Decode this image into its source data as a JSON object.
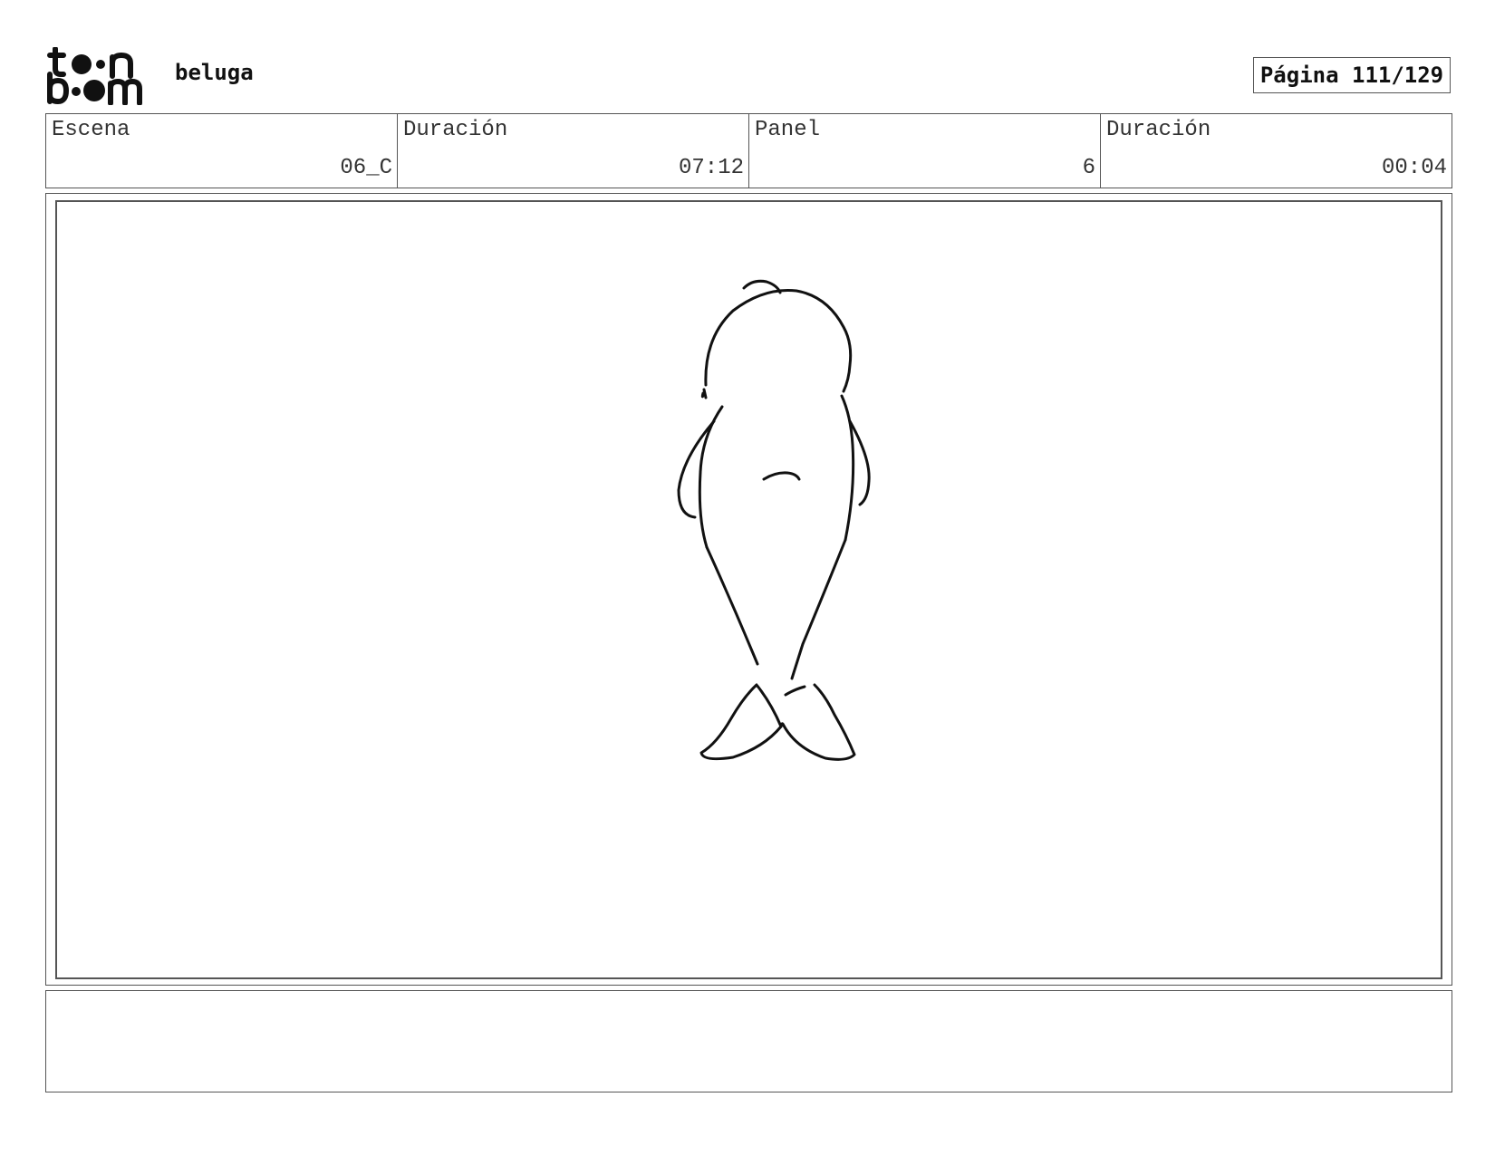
{
  "header": {
    "logo_text_top": "toon",
    "logo_text_bottom": "boom",
    "project_title": "beluga",
    "page_label": "Página 111/129"
  },
  "info": [
    {
      "label": "Escena",
      "value": "06_C"
    },
    {
      "label": "Duración",
      "value": "07:12"
    },
    {
      "label": "Panel",
      "value": "6"
    },
    {
      "label": "Duración",
      "value": "00:04"
    }
  ],
  "panel": {
    "drawing": "beluga-sketch"
  },
  "notes": {
    "text": ""
  }
}
